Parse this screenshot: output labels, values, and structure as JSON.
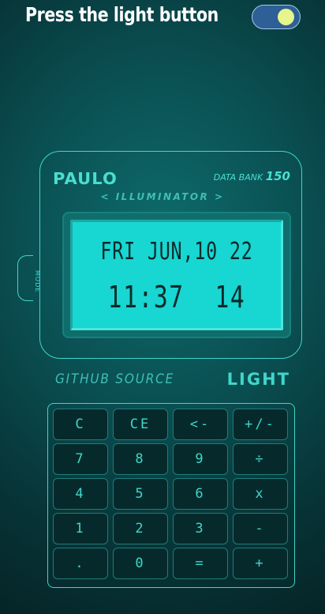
{
  "header": {
    "title": "Press the light button",
    "light_toggle_on": true,
    "toggle_color": "#2e5f96",
    "knob_color": "#e6f58c"
  },
  "watch": {
    "brand": "PAULO",
    "model_prefix": "DATA BANK",
    "model_number": "150",
    "illuminator": "< ILLUMINATOR >",
    "mode_label": "MODE",
    "date_text": "FRI  JUN,10  22",
    "time_text": "11:37  14",
    "accent_color": "#3fd6c9",
    "screen_color": "#18d6d2"
  },
  "links": {
    "github": "GITHUB SOURCE",
    "light": "LIGHT"
  },
  "keypad": {
    "keys": [
      "C",
      "CE",
      "<-",
      "+/-",
      "7",
      "8",
      "9",
      "÷",
      "4",
      "5",
      "6",
      "x",
      "1",
      "2",
      "3",
      "-",
      ".",
      "0",
      "=",
      "+"
    ]
  }
}
